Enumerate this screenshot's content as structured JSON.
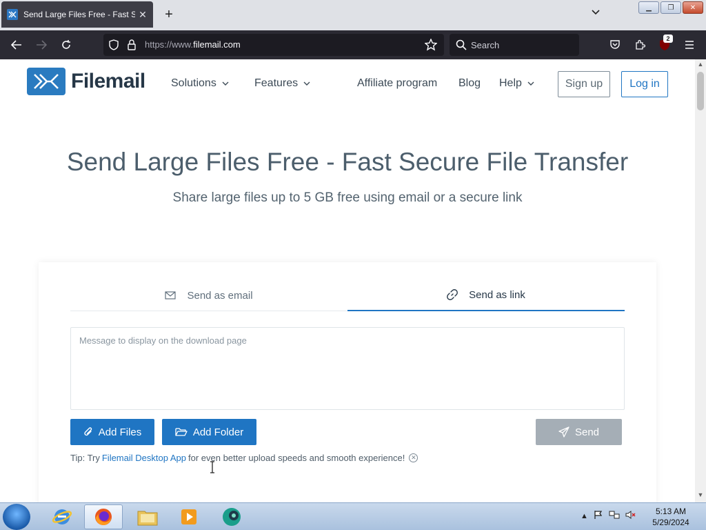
{
  "browser": {
    "tab_title": "Send Large Files Free - Fast Secure File Transfer",
    "url_scheme": "https://www.",
    "url_host": "filemail.com",
    "search_placeholder": "Search",
    "extension_badge": "2"
  },
  "site": {
    "brand": "Filemail",
    "nav": {
      "solutions": "Solutions",
      "features": "Features",
      "affiliate": "Affiliate program",
      "blog": "Blog",
      "help": "Help"
    },
    "signup_label": "Sign up",
    "login_label": "Log in",
    "colors": {
      "accent": "#1f75c3",
      "heading": "#4c5e6c",
      "brand_dark": "#263747"
    }
  },
  "hero": {
    "title": "Send Large Files Free - Fast Secure File Transfer",
    "subtitle": "Share large files up to 5 GB free using email or a secure link"
  },
  "transfer": {
    "tabs": [
      {
        "label": "Send as email",
        "icon": "envelope-icon",
        "active": false
      },
      {
        "label": "Send as link",
        "icon": "link-icon",
        "active": true
      }
    ],
    "message_placeholder": "Message to display on the download page",
    "add_files_label": "Add Files",
    "add_folder_label": "Add Folder",
    "send_label": "Send",
    "tip_prefix": "Tip: Try",
    "tip_link": "Filemail Desktop App",
    "tip_suffix": "for even better upload speeds and smooth experience!"
  },
  "taskbar": {
    "time": "5:13 AM",
    "date": "5/29/2024"
  }
}
